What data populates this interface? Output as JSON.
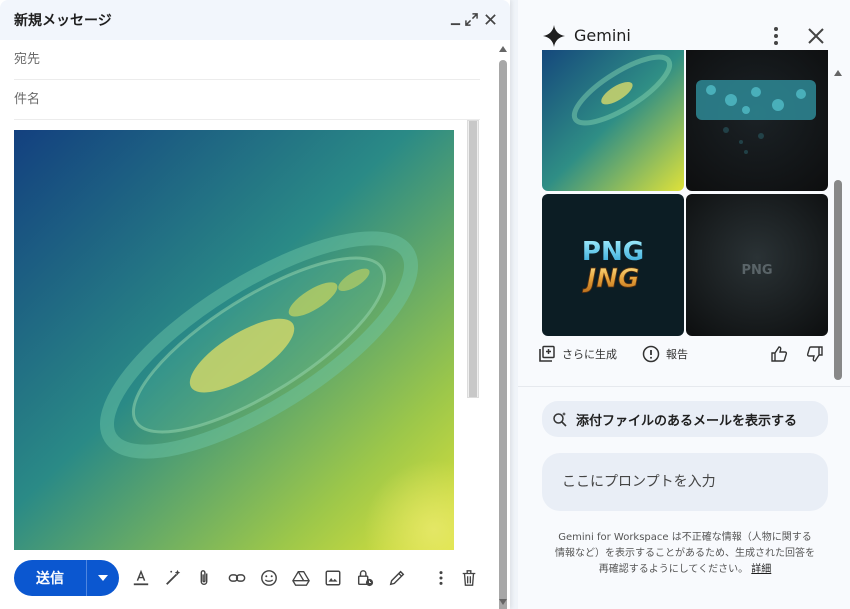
{
  "compose": {
    "title": "新規メッセージ",
    "to_placeholder": "宛先",
    "subject_placeholder": "件名",
    "send_label": "送信"
  },
  "gemini": {
    "title": "Gemini",
    "image_labels": {
      "png_top": "PNG",
      "png_bottom": "JNG",
      "png_gray": "PNG"
    },
    "actions": {
      "generate_more": "さらに生成",
      "report": "報告"
    },
    "suggestion": "添付ファイルのあるメールを表示する",
    "prompt_placeholder": "ここにプロンプトを入力",
    "disclaimer_text": "Gemini for Workspace は不正確な情報（人物に関する情報など）を表示することがあるため、生成された回答を再確認するようにしてください。",
    "disclaimer_link": "詳細"
  },
  "colors": {
    "send_blue": "#0b57d0",
    "panel_bg": "#f8fafd",
    "chip_bg": "#e9eef6"
  }
}
